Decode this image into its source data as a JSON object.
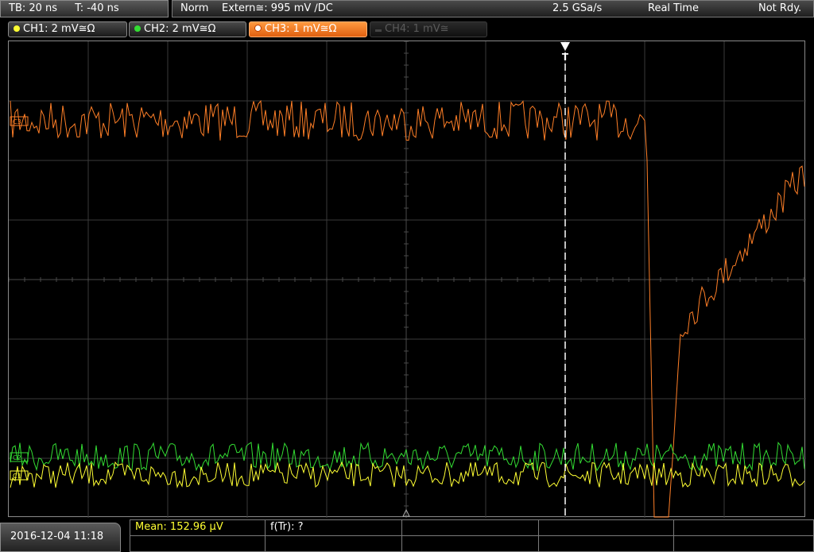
{
  "topbar": {
    "timebase": "TB: 20 ns",
    "trigger_offset": "T: -40 ns",
    "mode": "Norm",
    "trigger_source": "Extern≅: 995 mV ∕DC",
    "sample_rate": "2.5 GSa/s",
    "acq_mode": "Real Time",
    "status": "Not Rdy."
  },
  "channels": [
    {
      "label": "CH1: 2 mV≅Ω",
      "color": "#ffff33",
      "state": "on"
    },
    {
      "label": "CH2: 2 mV≅Ω",
      "color": "#33dd33",
      "state": "on"
    },
    {
      "label": "CH3: 1 mV≅Ω",
      "color": "#ff7f27",
      "state": "active"
    },
    {
      "label": "CH4: 1 mV≅",
      "color": "#555555",
      "state": "off"
    }
  ],
  "markers": {
    "trigger_label": "T",
    "ch3_marker": "C3",
    "ch2_marker": "C2",
    "ch1_marker": "C1"
  },
  "measurements": {
    "mean": "Mean: 152.96 µV",
    "frequency": "f(Tr): ?"
  },
  "datetime": "2016-12-04 11:18",
  "colors": {
    "grid": "#3a3a3a",
    "ch1": "#ffff33",
    "ch2": "#33dd33",
    "ch3": "#ff7f27",
    "active_tab": "#ff7f27"
  }
}
